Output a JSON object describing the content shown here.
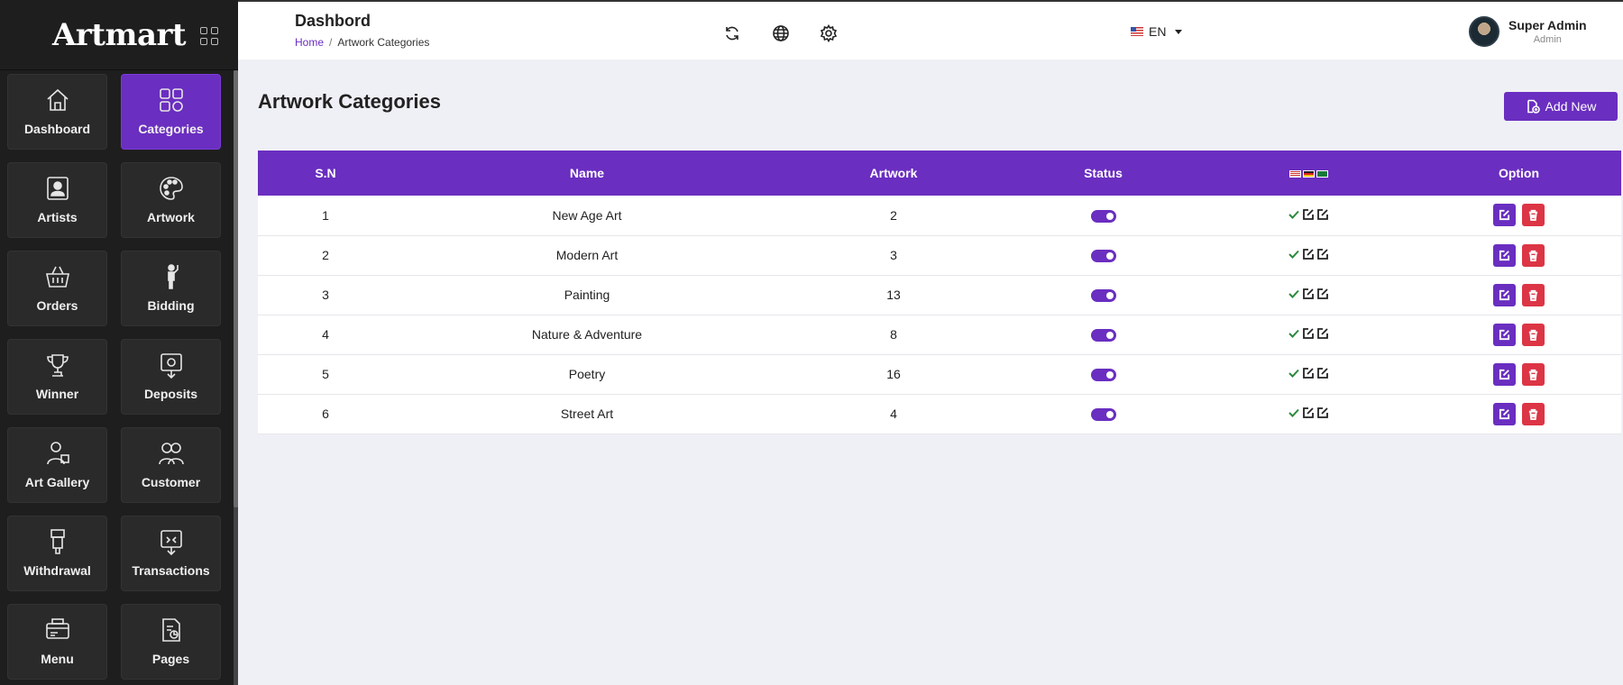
{
  "brand": {
    "name": "Artmart"
  },
  "sidebar": {
    "items": [
      {
        "label": "Dashboard",
        "icon": "home-icon",
        "active": false
      },
      {
        "label": "Categories",
        "icon": "categories-icon",
        "active": true
      },
      {
        "label": "Artists",
        "icon": "artist-icon",
        "active": false
      },
      {
        "label": "Artwork",
        "icon": "palette-icon",
        "active": false
      },
      {
        "label": "Orders",
        "icon": "basket-icon",
        "active": false
      },
      {
        "label": "Bidding",
        "icon": "bidding-icon",
        "active": false
      },
      {
        "label": "Winner",
        "icon": "trophy-icon",
        "active": false
      },
      {
        "label": "Deposits",
        "icon": "deposit-icon",
        "active": false
      },
      {
        "label": "Art Gallery",
        "icon": "gallery-icon",
        "active": false
      },
      {
        "label": "Customer",
        "icon": "customer-icon",
        "active": false
      },
      {
        "label": "Withdrawal",
        "icon": "withdrawal-icon",
        "active": false
      },
      {
        "label": "Transactions",
        "icon": "transactions-icon",
        "active": false
      },
      {
        "label": "Menu",
        "icon": "menu-icon",
        "active": false
      },
      {
        "label": "Pages",
        "icon": "pages-icon",
        "active": false
      }
    ]
  },
  "header": {
    "title": "Dashbord",
    "breadcrumb": {
      "home": "Home",
      "separator": "/",
      "current": "Artwork Categories"
    },
    "language": "EN",
    "user": {
      "name": "Super Admin",
      "role": "Admin"
    }
  },
  "main": {
    "title": "Artwork Categories",
    "add_button": "Add New",
    "table": {
      "headers": {
        "sn": "S.N",
        "name": "Name",
        "artwork": "Artwork",
        "status": "Status",
        "option": "Option"
      },
      "rows": [
        {
          "sn": "1",
          "name": "New Age Art",
          "artwork": "2",
          "status": true
        },
        {
          "sn": "2",
          "name": "Modern Art",
          "artwork": "3",
          "status": true
        },
        {
          "sn": "3",
          "name": "Painting",
          "artwork": "13",
          "status": true
        },
        {
          "sn": "4",
          "name": "Nature & Adventure",
          "artwork": "8",
          "status": true
        },
        {
          "sn": "5",
          "name": "Poetry",
          "artwork": "16",
          "status": true
        },
        {
          "sn": "6",
          "name": "Street Art",
          "artwork": "4",
          "status": true
        }
      ]
    }
  },
  "colors": {
    "accent": "#6a2ec0",
    "danger": "#dc3545",
    "sidebar_bg": "#1e1e1e"
  }
}
